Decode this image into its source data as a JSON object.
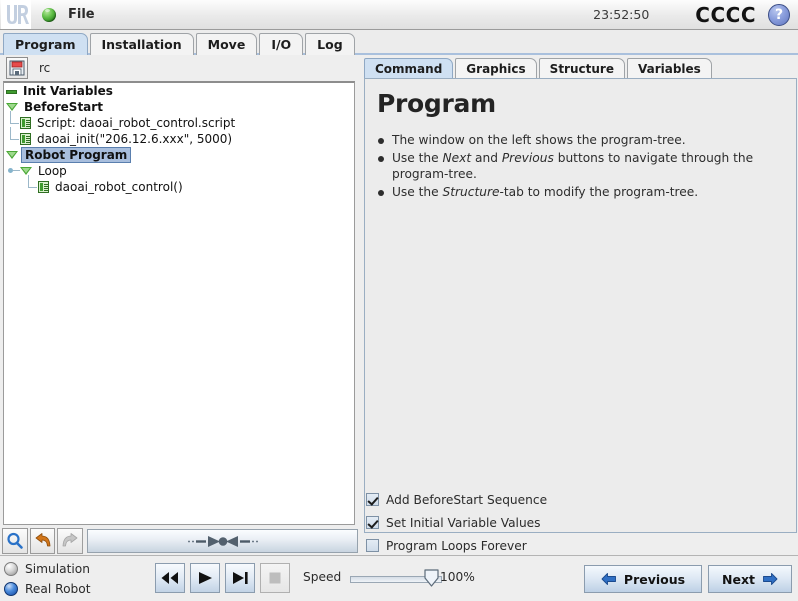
{
  "titlebar": {
    "logo_icon": "ur-logo-icon",
    "globe_icon": "globe-icon",
    "file_label": "File",
    "clock": "23:52:50",
    "brand": "CCCC",
    "help_icon": "help-question-icon",
    "help_label": "?"
  },
  "main_tabs": [
    {
      "label": "Program",
      "active": true
    },
    {
      "label": "Installation",
      "active": false
    },
    {
      "label": "Move",
      "active": false
    },
    {
      "label": "I/O",
      "active": false
    },
    {
      "label": "Log",
      "active": false
    }
  ],
  "left_panel": {
    "save_icon": "floppy-save-icon",
    "filename": "rc",
    "tree": [
      {
        "label": "Init Variables",
        "icon": "green-minus-icon",
        "depth": 0,
        "bold": true,
        "selected": false
      },
      {
        "label": "BeforeStart",
        "icon": "green-triangle-icon",
        "depth": 0,
        "bold": true,
        "selected": false
      },
      {
        "label": "Script: daoai_robot_control.script",
        "icon": "green-script-icon",
        "depth": 1,
        "bold": false,
        "selected": false
      },
      {
        "label": "daoai_init(\"206.12.6.xxx\", 5000)",
        "icon": "green-script-icon",
        "depth": 1,
        "bold": false,
        "selected": false
      },
      {
        "label": "Robot Program",
        "icon": "green-triangle-icon",
        "depth": 0,
        "bold": true,
        "selected": true
      },
      {
        "label": "Loop",
        "icon": "green-triangle-icon",
        "depth": 1,
        "bold": false,
        "selected": false
      },
      {
        "label": "daoai_robot_control()",
        "icon": "green-script-icon",
        "depth": 2,
        "bold": false,
        "selected": false
      }
    ]
  },
  "right_panel": {
    "tabs": [
      {
        "label": "Command",
        "active": true
      },
      {
        "label": "Graphics",
        "active": false
      },
      {
        "label": "Structure",
        "active": false
      },
      {
        "label": "Variables",
        "active": false
      }
    ],
    "title": "Program",
    "bullets": [
      {
        "pre": "The window on the left shows the program-tree.",
        "em": "",
        "post": ""
      },
      {
        "pre": "Use the ",
        "em": "Next",
        "mid": " and ",
        "em2": "Previous",
        "post": " buttons to navigate through the program-tree."
      },
      {
        "pre": "Use the ",
        "em": "Structure",
        "post": "-tab to modify the program-tree."
      }
    ],
    "bullet_1_text": "The window on the left shows the program-tree.",
    "bullet_2_pre": "Use the ",
    "bullet_2_em1": "Next",
    "bullet_2_mid": " and ",
    "bullet_2_em2": "Previous",
    "bullet_2_post": " buttons to navigate through the program-tree.",
    "bullet_3_pre": "Use the ",
    "bullet_3_em1": "Structure",
    "bullet_3_post": "-tab to modify the program-tree."
  },
  "checkboxes": [
    {
      "label": "Add BeforeStart Sequence",
      "checked": true
    },
    {
      "label": "Set Initial Variable Values",
      "checked": true
    },
    {
      "label": "Program Loops Forever",
      "checked": false
    }
  ],
  "low_toolbar": {
    "search_icon": "magnifier-search-icon",
    "undo_icon": "undo-arrow-icon",
    "redo_icon": "redo-arrow-icon",
    "drag_indicator_icon": "drag-handle-icon"
  },
  "bottom_bar": {
    "radios": [
      {
        "label": "Simulation",
        "selected": false
      },
      {
        "label": "Real Robot",
        "selected": true
      }
    ],
    "transport": [
      {
        "icon": "rewind-icon",
        "enabled": true
      },
      {
        "icon": "play-icon",
        "enabled": true
      },
      {
        "icon": "step-forward-icon",
        "enabled": true
      },
      {
        "icon": "stop-icon",
        "enabled": false
      }
    ],
    "speed_label": "Speed",
    "speed_value": "100%",
    "speed_percent": 100,
    "previous_label": "Previous",
    "next_label": "Next",
    "previous_icon": "arrow-left-icon",
    "next_icon": "arrow-right-icon"
  },
  "colors": {
    "tab_active": "#cfe0f2",
    "selection": "#a8bedd",
    "tree_icon_green": "#3f9b2f",
    "accent_blue": "#4e8ede",
    "undo_orange": "#d2761a"
  }
}
